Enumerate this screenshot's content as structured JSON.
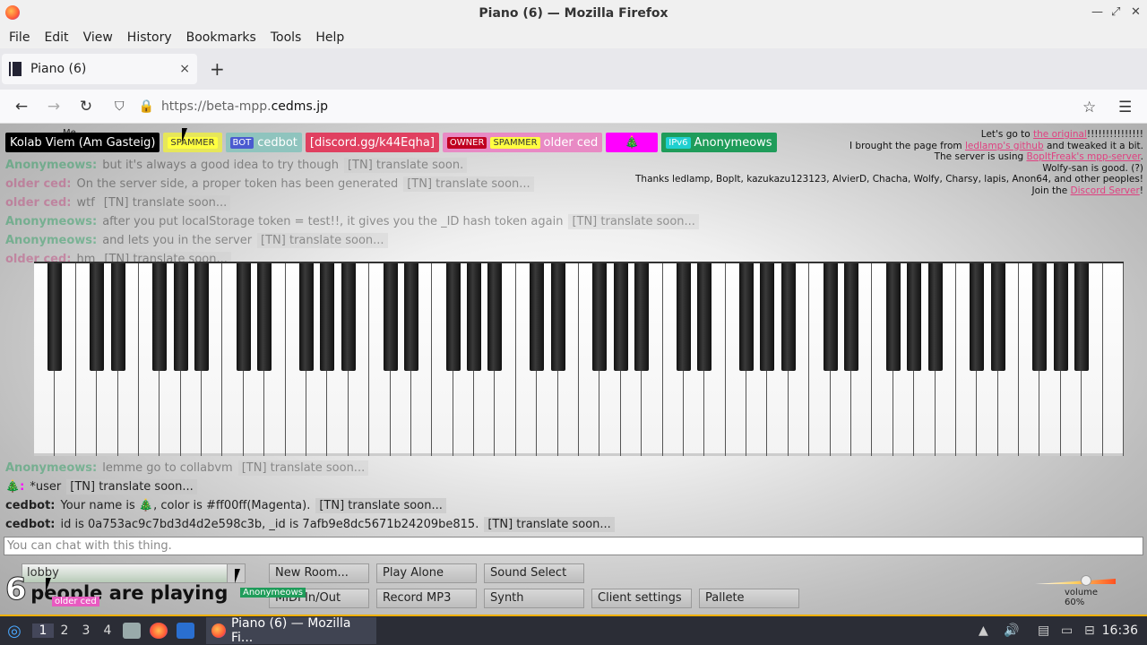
{
  "window": {
    "title": "Piano (6) — Mozilla Firefox"
  },
  "menu": [
    "File",
    "Edit",
    "View",
    "History",
    "Bookmarks",
    "Tools",
    "Help"
  ],
  "tab": {
    "label": "Piano (6)",
    "close": "×",
    "new": "+"
  },
  "nav": {
    "url_prefix": "https://beta-mpp.",
    "url_domain": "cedms.jp"
  },
  "namebar": {
    "me_label": "Me",
    "users": [
      {
        "name": "Kolab Viem (Am Gasteig)",
        "tag": "",
        "color": "#000000"
      },
      {
        "name": "",
        "tag": "SPAMMER",
        "color": "#e6e65a"
      },
      {
        "name": "cedbot",
        "tag": "BOT",
        "color": "#8fc4be"
      },
      {
        "name": "[discord.gg/k44Eqha]",
        "tag": "",
        "color": "#e04060"
      },
      {
        "name": "older ced",
        "tag": "OWNER",
        "tag2": "SPAMMER",
        "color": "#e88ac4"
      },
      {
        "name": "🎄",
        "tag": "",
        "color": "#ff00ff"
      },
      {
        "name": "Anonymeows",
        "tag": "IPv6",
        "color": "#1f9c5a"
      }
    ]
  },
  "info": {
    "l1a": "Let's go to ",
    "l1link": "the original",
    "l1b": "!!!!!!!!!!!!!!!",
    "l2a": "I brought the page from ",
    "l2link": "ledlamp's github",
    "l2b": " and tweaked it a bit.",
    "l3a": "The server is using ",
    "l3link": "BopItFreak's mpp-server",
    "l3b": ".",
    "l4": "Wolfy-san is good. (?)",
    "l5": "Thanks ledlamp, BopIt, kazukazu123123, AlvierD, Chacha, Wolfy, Charsy, lapis, Anon64, and other peoples!",
    "l6a": "Join the ",
    "l6link": "Discord Server",
    "l6b": "!"
  },
  "chat": [
    {
      "who": "Anonymeows:",
      "msg": "but it's always a good idea to try though",
      "tn": "[TN] translate soon.",
      "color": "#1f9c5a",
      "fade": true
    },
    {
      "who": "older ced:",
      "msg": "On the server side, a proper token has been generated",
      "tn": "[TN] translate soon...",
      "color": "#c0407a",
      "fade": true
    },
    {
      "who": "older ced:",
      "msg": "wtf",
      "tn": "[TN] translate soon...",
      "color": "#c0407a",
      "fade": true
    },
    {
      "who": "Anonymeows:",
      "msg": "after you put localStorage token = test!!, it gives you the _ID hash token again",
      "tn": "[TN] translate soon...",
      "color": "#1f9c5a",
      "fade": true
    },
    {
      "who": "Anonymeows:",
      "msg": "and lets you in the server",
      "tn": "[TN] translate soon...",
      "color": "#1f9c5a",
      "fade": true
    },
    {
      "who": "older ced:",
      "msg": "hm",
      "tn": "[TN] translate soon...",
      "color": "#c0407a",
      "fade": true
    },
    {
      "who": "Anonymeows:",
      "msg": "lemme go to collabvm",
      "tn": "[TN] translate soon...",
      "color": "#1f9c5a",
      "fade": true
    },
    {
      "who": "🎄:",
      "msg": "*user",
      "tn": "[TN] translate soon...",
      "color": "#ff00ff",
      "fade": false
    },
    {
      "who": "cedbot:",
      "msg": "Your name is 🎄, color is #ff00ff(Magenta).",
      "tn": "[TN] translate soon...",
      "color": "#222222",
      "fade": false
    },
    {
      "who": "cedbot:",
      "msg": "id is 0a753ac9c7bd3d4d2e598c3b, _id is 7afb9e8dc5671b24209be815.",
      "tn": "[TN] translate soon...",
      "color": "#222222",
      "fade": false
    }
  ],
  "chat_placeholder": "You can chat with this thing.",
  "controls": {
    "room": "lobby",
    "players_count": "6",
    "players_text": "people are playing",
    "buttons_row1": [
      "New Room...",
      "Play Alone",
      "Sound Select"
    ],
    "buttons_row2": [
      "MIDI In/Out",
      "Record MP3",
      "Synth",
      "Client settings",
      "Pallete"
    ],
    "anon_badge": "Anonymeows",
    "older_badge": "older ced",
    "volume_label": "volume 60%",
    "volume": 0.6
  },
  "taskbar": {
    "workspaces": [
      "1",
      "2",
      "3",
      "4"
    ],
    "task": "Piano (6) — Mozilla Fi...",
    "clock": "16:36"
  }
}
